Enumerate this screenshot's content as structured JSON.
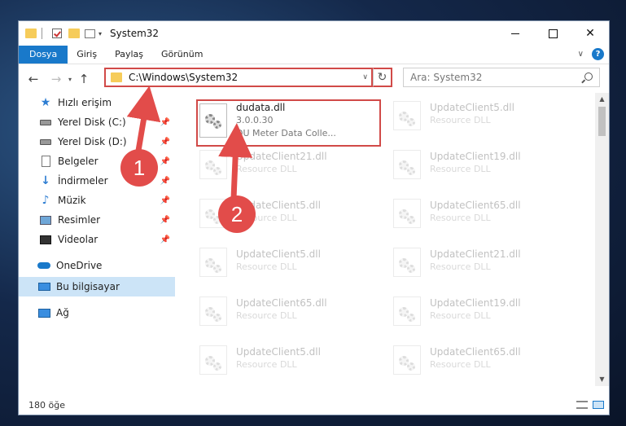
{
  "window": {
    "title": "System32",
    "controls": {
      "minimize": "",
      "maximize": "",
      "close": "✕"
    }
  },
  "ribbon": {
    "tabs": [
      "Dosya",
      "Giriş",
      "Paylaş",
      "Görünüm"
    ],
    "help": "?"
  },
  "address": {
    "path": "C:\\Windows\\System32",
    "search_placeholder": "Ara: System32"
  },
  "sidebar": {
    "quick_access": "Hızlı erişim",
    "pinned": [
      {
        "label": "Yerel Disk (C:)",
        "icon": "drive-icon"
      },
      {
        "label": "Yerel Disk (D:)",
        "icon": "drive-icon"
      },
      {
        "label": "Belgeler",
        "icon": "documents-icon"
      },
      {
        "label": "İndirmeler",
        "icon": "download-icon"
      },
      {
        "label": "Müzik",
        "icon": "music-icon"
      },
      {
        "label": "Resimler",
        "icon": "pictures-icon"
      },
      {
        "label": "Videolar",
        "icon": "videos-icon"
      }
    ],
    "onedrive": "OneDrive",
    "this_pc": "Bu bilgisayar",
    "network": "Ağ"
  },
  "files": {
    "highlighted": {
      "name": "dudata.dll",
      "version": "3.0.0.30",
      "description": "DU Meter Data Colle..."
    },
    "others": [
      {
        "name": "UpdateClient5.dll",
        "type": "Resource DLL"
      },
      {
        "name": "UpdateClient21.dll",
        "type": "Resource DLL"
      },
      {
        "name": "UpdateClient19.dll",
        "type": "Resource DLL"
      },
      {
        "name": "UpdateClient5.dll",
        "type": "Resource DLL"
      },
      {
        "name": "UpdateClient65.dll",
        "type": "Resource DLL"
      },
      {
        "name": "UpdateClient5.dll",
        "type": "Resource DLL"
      },
      {
        "name": "UpdateClient21.dll",
        "type": "Resource DLL"
      },
      {
        "name": "UpdateClient65.dll",
        "type": "Resource DLL"
      },
      {
        "name": "UpdateClient19.dll",
        "type": "Resource DLL"
      },
      {
        "name": "UpdateClient5.dll",
        "type": "Resource DLL"
      },
      {
        "name": "UpdateClient65.dll",
        "type": "Resource DLL"
      }
    ]
  },
  "status": {
    "item_count": "180 öğe"
  },
  "annotations": {
    "step1": "1",
    "step2": "2",
    "color": "#e24c4a"
  }
}
